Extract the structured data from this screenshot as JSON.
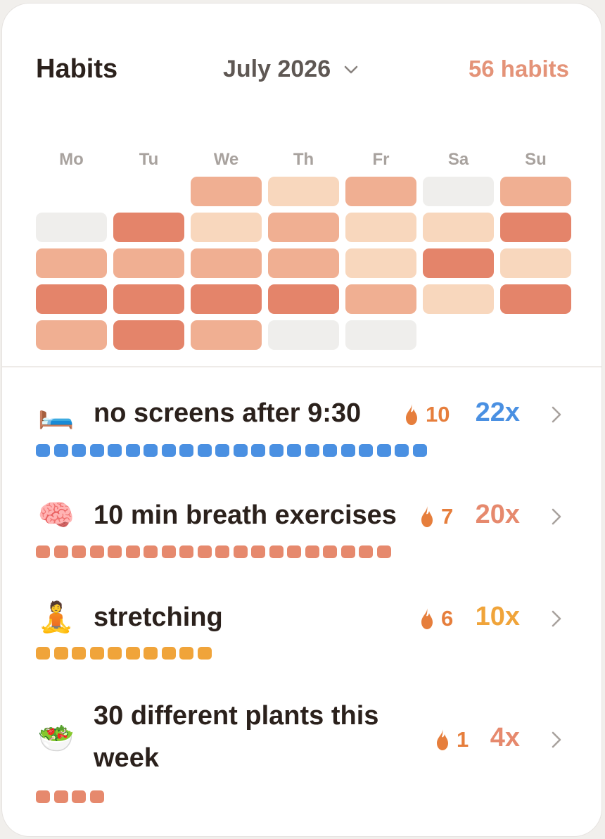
{
  "header": {
    "title": "Habits",
    "month": "July 2026",
    "habit_count": "56 habits"
  },
  "calendar": {
    "weekdays": [
      "Mo",
      "Tu",
      "We",
      "Th",
      "Fr",
      "Sa",
      "Su"
    ],
    "intensity_colors": [
      "#efeeec",
      "#f8d7bd",
      "#f0af92",
      "#e4846a"
    ],
    "weeks": [
      [
        null,
        null,
        2,
        1,
        2,
        0,
        2
      ],
      [
        0,
        3,
        1,
        2,
        1,
        1,
        3
      ],
      [
        2,
        2,
        2,
        2,
        1,
        3,
        1
      ],
      [
        3,
        3,
        3,
        3,
        2,
        1,
        3
      ],
      [
        2,
        3,
        2,
        0,
        0,
        null,
        null
      ]
    ]
  },
  "habits": [
    {
      "emoji": "🛏️",
      "icon": "bed-icon",
      "name": "no screens after 9:30",
      "streak": "10",
      "total": "22x",
      "completions": 22,
      "color": "#4a90e2",
      "streak_color": "#e67e3c"
    },
    {
      "emoji": "🧠",
      "icon": "brain-icon",
      "name": "10 min breath exercises",
      "streak": "7",
      "total": "20x",
      "completions": 20,
      "color": "#e6896d",
      "streak_color": "#e67e3c"
    },
    {
      "emoji": "🧘",
      "icon": "meditation-icon",
      "name": "stretching",
      "streak": "6",
      "total": "10x",
      "completions": 10,
      "color": "#f0a43a",
      "streak_color": "#e67e3c"
    },
    {
      "emoji": "🥗",
      "icon": "salad-icon",
      "name": "30 different plants this week",
      "streak": "1",
      "total": "4x",
      "completions": 4,
      "color": "#e6896d",
      "streak_color": "#e67e3c"
    }
  ]
}
